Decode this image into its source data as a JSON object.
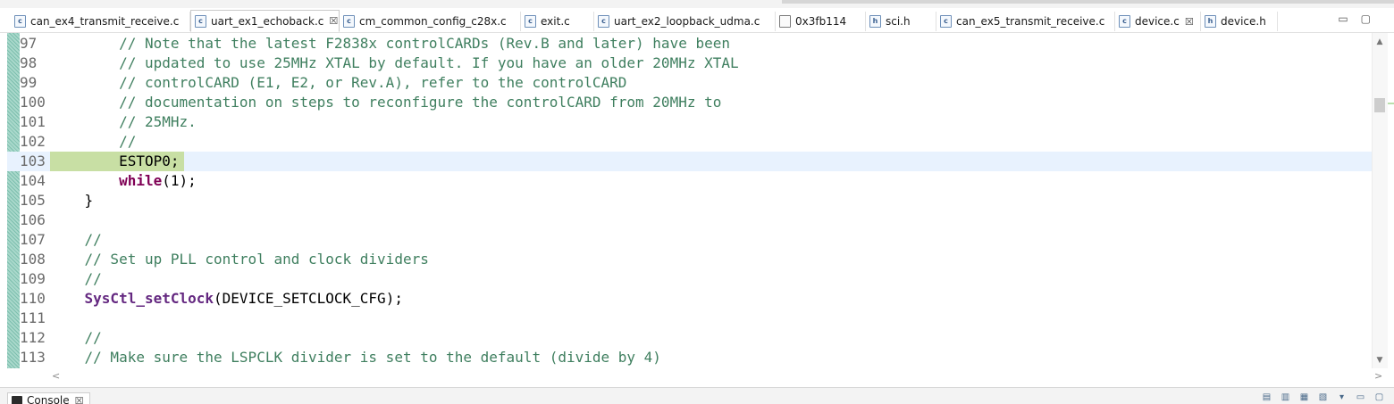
{
  "tabs": [
    {
      "label": "can_ex4_transmit_receive.c",
      "icon": "c",
      "active": false,
      "closable": false
    },
    {
      "label": "uart_ex1_echoback.c",
      "icon": "c",
      "active": true,
      "closable": true
    },
    {
      "label": "cm_common_config_c28x.c",
      "icon": "c",
      "active": false,
      "closable": false
    },
    {
      "label": "exit.c",
      "icon": "c",
      "active": false,
      "closable": false
    },
    {
      "label": "uart_ex2_loopback_udma.c",
      "icon": "c",
      "active": false,
      "closable": false
    },
    {
      "label": "0x3fb114",
      "icon": "hex",
      "active": false,
      "closable": false
    },
    {
      "label": "sci.h",
      "icon": "h",
      "active": false,
      "closable": false
    },
    {
      "label": "can_ex5_transmit_receive.c",
      "icon": "c",
      "active": false,
      "closable": false
    },
    {
      "label": "device.c",
      "icon": "c",
      "active": false,
      "closable": true
    },
    {
      "label": "device.h",
      "icon": "h",
      "active": false,
      "closable": false
    }
  ],
  "tab_close_glyph": "☒",
  "tabbar_controls": [
    "▭",
    "▢"
  ],
  "editor": {
    "lines": [
      {
        "num": "97",
        "tokens": [
          {
            "t": "        ",
            "k": "plain"
          },
          {
            "t": "// Note that the latest F2838x controlCARDs (Rev.B and later) have been",
            "k": "comment"
          }
        ]
      },
      {
        "num": "98",
        "tokens": [
          {
            "t": "        ",
            "k": "plain"
          },
          {
            "t": "// updated to use 25MHz XTAL by default. If you have an older 20MHz XTAL",
            "k": "comment"
          }
        ]
      },
      {
        "num": "99",
        "tokens": [
          {
            "t": "        ",
            "k": "plain"
          },
          {
            "t": "// controlCARD (E1, E2, or Rev.A), refer to the controlCARD",
            "k": "comment"
          }
        ]
      },
      {
        "num": "100",
        "tokens": [
          {
            "t": "        ",
            "k": "plain"
          },
          {
            "t": "// documentation on steps to reconfigure the controlCARD from 20MHz to",
            "k": "comment"
          }
        ]
      },
      {
        "num": "101",
        "tokens": [
          {
            "t": "        ",
            "k": "plain"
          },
          {
            "t": "// 25MHz.",
            "k": "comment"
          }
        ]
      },
      {
        "num": "102",
        "tokens": [
          {
            "t": "        ",
            "k": "plain"
          },
          {
            "t": "//",
            "k": "comment"
          }
        ]
      },
      {
        "num": "103",
        "current": true,
        "tokens": [
          {
            "t": "        ",
            "k": "plain"
          },
          {
            "t": "ESTOP0;",
            "k": "plain"
          }
        ]
      },
      {
        "num": "104",
        "tokens": [
          {
            "t": "        ",
            "k": "plain"
          },
          {
            "t": "while",
            "k": "kw"
          },
          {
            "t": "(1);",
            "k": "plain"
          }
        ]
      },
      {
        "num": "105",
        "tokens": [
          {
            "t": "    }",
            "k": "plain"
          }
        ]
      },
      {
        "num": "106",
        "tokens": []
      },
      {
        "num": "107",
        "tokens": [
          {
            "t": "    ",
            "k": "plain"
          },
          {
            "t": "//",
            "k": "comment"
          }
        ]
      },
      {
        "num": "108",
        "tokens": [
          {
            "t": "    ",
            "k": "plain"
          },
          {
            "t": "// Set up PLL control and clock dividers",
            "k": "comment"
          }
        ]
      },
      {
        "num": "109",
        "tokens": [
          {
            "t": "    ",
            "k": "plain"
          },
          {
            "t": "//",
            "k": "comment"
          }
        ]
      },
      {
        "num": "110",
        "tokens": [
          {
            "t": "    ",
            "k": "plain"
          },
          {
            "t": "SysCtl_setClock",
            "k": "fn"
          },
          {
            "t": "(DEVICE_SETCLOCK_CFG);",
            "k": "plain"
          }
        ]
      },
      {
        "num": "111",
        "tokens": []
      },
      {
        "num": "112",
        "tokens": [
          {
            "t": "    ",
            "k": "plain"
          },
          {
            "t": "//",
            "k": "comment"
          }
        ]
      },
      {
        "num": "113",
        "tokens": [
          {
            "t": "    ",
            "k": "plain"
          },
          {
            "t": "// Make sure the LSPCLK divider is set to the default (divide by 4)",
            "k": "comment"
          }
        ]
      }
    ]
  },
  "scroll": {
    "up": "▲",
    "down": "▼",
    "left": "<",
    "right": ">"
  },
  "console": {
    "label": "Console",
    "close_glyph": "☒"
  },
  "colors": {
    "comment": "#3f7f5f",
    "keyword": "#7f0055",
    "function": "#642880",
    "current_line": "#e8f2fe",
    "selection": "#c8dfa4"
  }
}
